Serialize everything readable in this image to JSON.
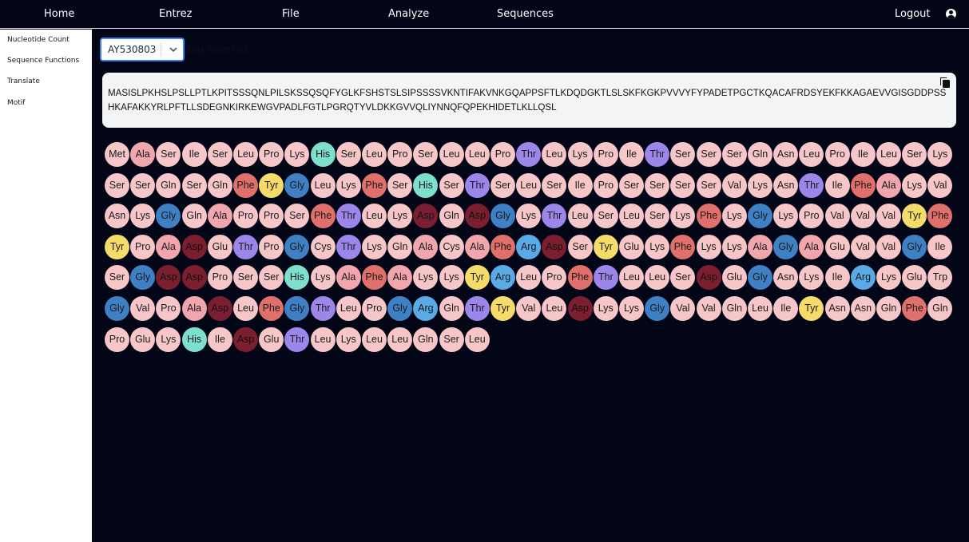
{
  "nav": {
    "items": [
      "Home",
      "Entrez",
      "File",
      "Analyze",
      "Sequences"
    ],
    "logout": "Logout",
    "user_icon": "user-circle-icon"
  },
  "sidebar": {
    "items": [
      "Nucleotide Count",
      "Sequence Functions",
      "Translate",
      "Motif"
    ]
  },
  "selector": {
    "value": "AY530803",
    "status": "seq selected"
  },
  "sequence": {
    "text": "MASISLPKHSLPSLLPTLKPITSSSQNLPILSKSSQSQFYGLKFSHSTSLSIPSSSSVKNTIFAKVNKGQAPPSFTLKDQDGKTLSLSKFKGKPVVVYFYPADETPGCTKQACAFRDSYEKFKKAGAEVVGISGDDPSSHKAFAKKYRLPFTLLSDEGNKIRKEWGVPADLFGTLPGRQTYVLDKKGVVQLIYNNQFQPEKHIDETLKLLQSL",
    "copy_icon": "copy-icon"
  },
  "colors": {
    "Ala": "#f0a6ac",
    "Arg": "#5aaae8",
    "Asn": "#f6c6c8",
    "Asp": "#7b1e30",
    "Cys": "#f6c6c8",
    "Gln": "#f6c6c8",
    "Glu": "#f6c6c8",
    "Gly": "#3f80c4",
    "His": "#7ee0cc",
    "Ile": "#f6c6c8",
    "Leu": "#f6c6c8",
    "Lys": "#f6c6c8",
    "Met": "#f6c6c8",
    "Phe": "#e0706c",
    "Pro": "#f6c6c8",
    "Ser": "#f6c6c8",
    "Thr": "#9d86ea",
    "Trp": "#f6c6c8",
    "Tyr": "#f5dc6a",
    "Val": "#f6c6c8"
  },
  "amino_acids": [
    "Met",
    "Ala",
    "Ser",
    "Ile",
    "Ser",
    "Leu",
    "Pro",
    "Lys",
    "His",
    "Ser",
    "Leu",
    "Pro",
    "Ser",
    "Leu",
    "Leu",
    "Pro",
    "Thr",
    "Leu",
    "Lys",
    "Pro",
    "Ile",
    "Thr",
    "Ser",
    "Ser",
    "Ser",
    "Gln",
    "Asn",
    "Leu",
    "Pro",
    "Ile",
    "Leu",
    "Ser",
    "Lys",
    "Ser",
    "Ser",
    "Gln",
    "Ser",
    "Gln",
    "Phe",
    "Tyr",
    "Gly",
    "Leu",
    "Lys",
    "Phe",
    "Ser",
    "His",
    "Ser",
    "Thr",
    "Ser",
    "Leu",
    "Ser",
    "Ile",
    "Pro",
    "Ser",
    "Ser",
    "Ser",
    "Ser",
    "Val",
    "Lys",
    "Asn",
    "Thr",
    "Ile",
    "Phe",
    "Ala",
    "Lys",
    "Val",
    "Asn",
    "Lys",
    "Gly",
    "Gln",
    "Ala",
    "Pro",
    "Pro",
    "Ser",
    "Phe",
    "Thr",
    "Leu",
    "Lys",
    "Asp",
    "Gln",
    "Asp",
    "Gly",
    "Lys",
    "Thr",
    "Leu",
    "Ser",
    "Leu",
    "Ser",
    "Lys",
    "Phe",
    "Lys",
    "Gly",
    "Lys",
    "Pro",
    "Val",
    "Val",
    "Val",
    "Tyr",
    "Phe",
    "Tyr",
    "Pro",
    "Ala",
    "Asp",
    "Glu",
    "Thr",
    "Pro",
    "Gly",
    "Cys",
    "Thr",
    "Lys",
    "Gln",
    "Ala",
    "Cys",
    "Ala",
    "Phe",
    "Arg",
    "Asp",
    "Ser",
    "Tyr",
    "Glu",
    "Lys",
    "Phe",
    "Lys",
    "Lys",
    "Ala",
    "Gly",
    "Ala",
    "Glu",
    "Val",
    "Val",
    "Gly",
    "Ile",
    "Ser",
    "Gly",
    "Asp",
    "Asp",
    "Pro",
    "Ser",
    "Ser",
    "His",
    "Lys",
    "Ala",
    "Phe",
    "Ala",
    "Lys",
    "Lys",
    "Tyr",
    "Arg",
    "Leu",
    "Pro",
    "Phe",
    "Thr",
    "Leu",
    "Leu",
    "Ser",
    "Asp",
    "Glu",
    "Gly",
    "Asn",
    "Lys",
    "Ile",
    "Arg",
    "Lys",
    "Glu",
    "Trp",
    "Gly",
    "Val",
    "Pro",
    "Ala",
    "Asp",
    "Leu",
    "Phe",
    "Gly",
    "Thr",
    "Leu",
    "Pro",
    "Gly",
    "Arg",
    "Gln",
    "Thr",
    "Tyr",
    "Val",
    "Leu",
    "Asp",
    "Lys",
    "Lys",
    "Gly",
    "Val",
    "Val",
    "Gln",
    "Leu",
    "Ile",
    "Tyr",
    "Asn",
    "Asn",
    "Gln",
    "Phe",
    "Gln",
    "Pro",
    "Glu",
    "Lys",
    "His",
    "Ile",
    "Asp",
    "Glu",
    "Thr",
    "Leu",
    "Lys",
    "Leu",
    "Leu",
    "Gln",
    "Ser",
    "Leu"
  ]
}
